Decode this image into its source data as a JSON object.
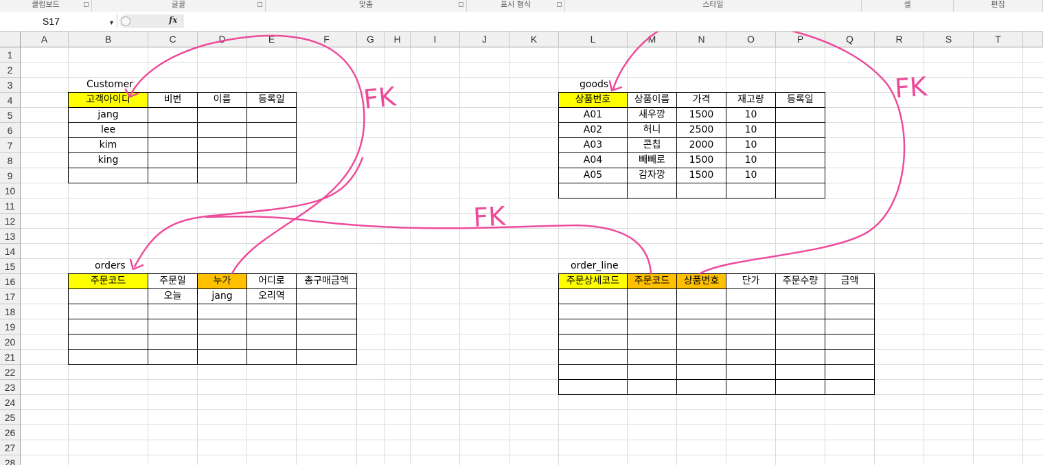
{
  "ribbon": {
    "groups": [
      {
        "label": "클립보드",
        "has_launcher": true
      },
      {
        "label": "글꼴",
        "has_launcher": true
      },
      {
        "label": "맞춤",
        "has_launcher": true
      },
      {
        "label": "표시 형식",
        "has_launcher": true
      },
      {
        "label": "스타일",
        "has_launcher": false
      },
      {
        "label": "셀",
        "has_launcher": false
      },
      {
        "label": "편집",
        "has_launcher": false
      }
    ]
  },
  "formula_bar": {
    "name_box": "S17",
    "fx_label": "fx",
    "formula": ""
  },
  "columns": [
    "A",
    "B",
    "C",
    "D",
    "E",
    "F",
    "G",
    "H",
    "I",
    "J",
    "K",
    "L",
    "M",
    "N",
    "O",
    "P",
    "Q",
    "R",
    "S",
    "T"
  ],
  "rows": [
    "1",
    "2",
    "3",
    "4",
    "5",
    "6",
    "7",
    "8",
    "9",
    "10",
    "11",
    "12",
    "13",
    "14",
    "15",
    "16",
    "17",
    "18",
    "19",
    "20",
    "21",
    "22",
    "23",
    "24",
    "25",
    "26",
    "27",
    "28"
  ],
  "tables": [
    {
      "title": "Customer",
      "headers": [
        "고객아이디",
        "비번",
        "이름",
        "등록일"
      ],
      "header_fills": [
        "yellow",
        "",
        "",
        ""
      ],
      "rows": [
        [
          "jang",
          "",
          "",
          ""
        ],
        [
          "lee",
          "",
          "",
          ""
        ],
        [
          "kim",
          "",
          "",
          ""
        ],
        [
          "king",
          "",
          "",
          ""
        ],
        [
          "",
          "",
          "",
          ""
        ]
      ]
    },
    {
      "title": "goods",
      "headers": [
        "상품번호",
        "상품이름",
        "가격",
        "재고량",
        "등록일"
      ],
      "header_fills": [
        "yellow",
        "",
        "",
        "",
        ""
      ],
      "rows": [
        [
          "A01",
          "새우깡",
          "1500",
          "10",
          ""
        ],
        [
          "A02",
          "허니",
          "2500",
          "10",
          ""
        ],
        [
          "A03",
          "콘칩",
          "2000",
          "10",
          ""
        ],
        [
          "A04",
          "빼빼로",
          "1500",
          "10",
          ""
        ],
        [
          "A05",
          "감자깡",
          "1500",
          "10",
          ""
        ],
        [
          "",
          "",
          "",
          "",
          ""
        ]
      ]
    },
    {
      "title": "orders",
      "headers": [
        "주문코드",
        "주문일",
        "누가",
        "어디로",
        "총구매금액"
      ],
      "header_fills": [
        "yellow",
        "",
        "orange",
        "",
        ""
      ],
      "rows": [
        [
          "",
          "오늘",
          "jang",
          "오리역",
          ""
        ],
        [
          "",
          "",
          "",
          "",
          ""
        ],
        [
          "",
          "",
          "",
          "",
          ""
        ],
        [
          "",
          "",
          "",
          "",
          ""
        ],
        [
          "",
          "",
          "",
          "",
          ""
        ]
      ]
    },
    {
      "title": "order_line",
      "headers": [
        "주문상세코드",
        "주문코드",
        "상품번호",
        "단가",
        "주문수량",
        "금액"
      ],
      "header_fills": [
        "yellow",
        "orange",
        "orange",
        "",
        "",
        ""
      ],
      "rows": [
        [
          "",
          "",
          "",
          "",
          "",
          ""
        ],
        [
          "",
          "",
          "",
          "",
          "",
          ""
        ],
        [
          "",
          "",
          "",
          "",
          "",
          ""
        ],
        [
          "",
          "",
          "",
          "",
          "",
          ""
        ],
        [
          "",
          "",
          "",
          "",
          "",
          ""
        ],
        [
          "",
          "",
          "",
          "",
          "",
          ""
        ],
        [
          "",
          "",
          "",
          "",
          "",
          ""
        ]
      ]
    }
  ],
  "annotations": [
    {
      "text": "FK",
      "color": "#ee4a9a"
    },
    {
      "text": "FK",
      "color": "#ee4a9a"
    },
    {
      "text": "FK",
      "color": "#ee4a9a"
    }
  ],
  "colors": {
    "ink": "#ee4a9a",
    "key_yellow": "#ffff00",
    "fk_orange": "#ffc000"
  }
}
